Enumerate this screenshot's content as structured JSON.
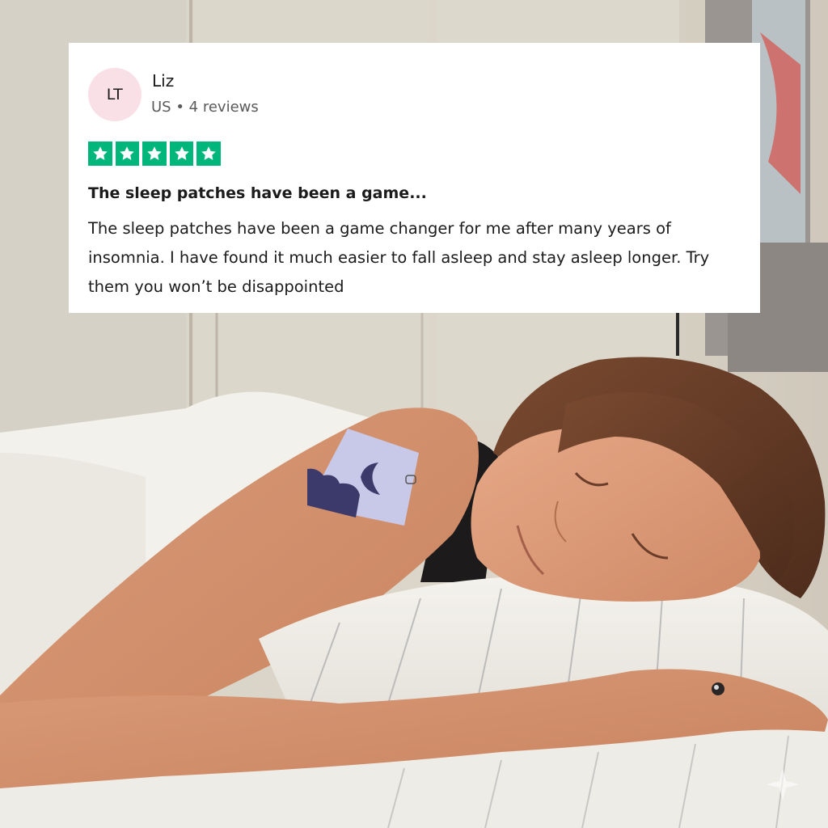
{
  "review": {
    "avatar_initials": "LT",
    "reviewer_name": "Liz",
    "reviewer_meta": "US • 4 reviews",
    "rating": 5,
    "rating_max": 5,
    "title": "The sleep patches have been a game...",
    "body": "The sleep patches have been a game changer for me after many years of insomnia. I have found it much easier to fall asleep and stay asleep longer. Try them you won’t be disappointed"
  },
  "colors": {
    "star_green": "#00b67a",
    "avatar_pink": "#f9dfe6",
    "card_bg": "#ffffff"
  },
  "photo": {
    "icons": [
      "patch-moon-icon"
    ]
  }
}
